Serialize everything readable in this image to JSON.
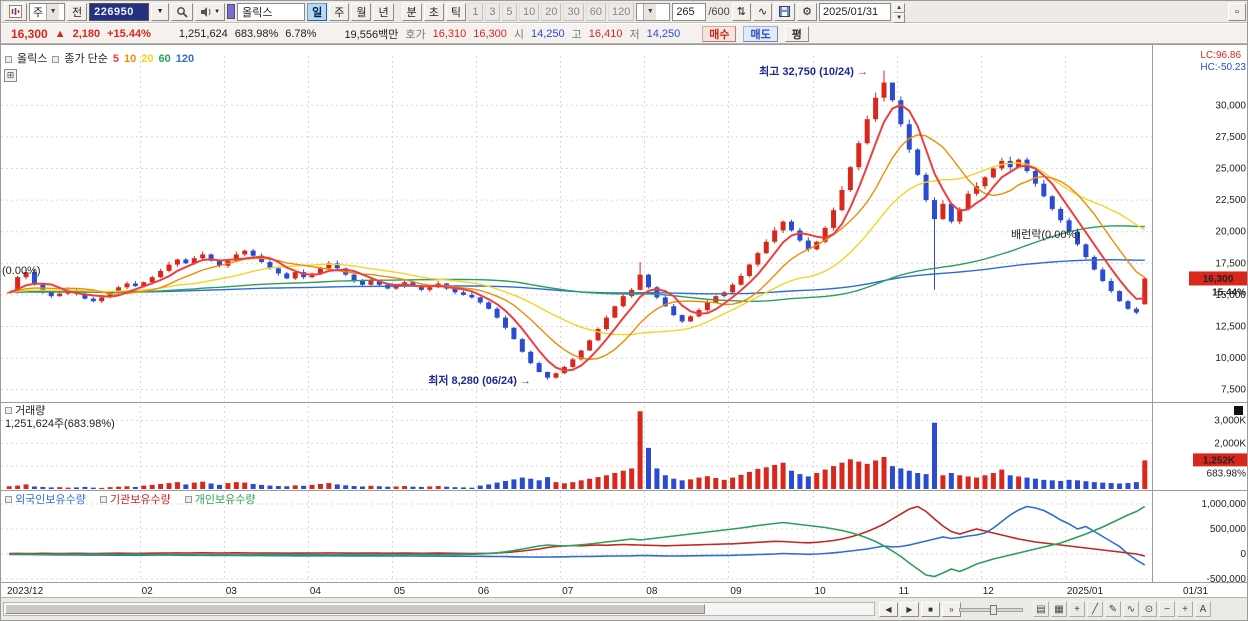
{
  "icons": {
    "caret_down": "▼",
    "spinner_up": "▲",
    "spinner_down": "▼",
    "arrow_right": "→",
    "updown": "⇅",
    "wave": "∿",
    "gear": "⚙",
    "square": "▫",
    "grid": "⊞"
  },
  "toolbar": {
    "market_type": "주",
    "prev_label": "전",
    "code_value": "226950",
    "name_value": "올릭스",
    "periods": [
      "일",
      "주",
      "월",
      "년",
      "분",
      "초",
      "틱"
    ],
    "active_period": "일",
    "minutes": [
      "1",
      "3",
      "5",
      "10",
      "20",
      "30",
      "60",
      "120"
    ],
    "count_value": "265",
    "count_total": "/600",
    "date_value": "2025/01/31"
  },
  "quote": {
    "price": "16,300",
    "arrow": "▲",
    "change": "2,180",
    "change_pct": "+15.44%",
    "volume": "1,251,624",
    "volume_pct": "683.98%",
    "turnover_pct": "6.78%",
    "value": "19,556백만",
    "hoga_label": "호가",
    "ask": "16,310",
    "bid": "16,300",
    "open_label": "시",
    "open": "14,250",
    "high_label": "고",
    "high": "16,410",
    "low_label": "저",
    "low": "14,250",
    "buy_button": "매수",
    "sell_button": "매도",
    "avg_button": "평"
  },
  "legend": {
    "name": "올릭스",
    "ma_label": "종가 단순",
    "ma_periods": [
      "5",
      "10",
      "20",
      "60",
      "120"
    ]
  },
  "corner": {
    "lc": "LC:96.86",
    "hc": "HC:-50.23"
  },
  "annotations": {
    "high": "최고 32,750 (10/24)",
    "low": "최저 8,280 (06/24)",
    "overlay": "배런락(0.00%)",
    "overlay_left": "(0.00%)"
  },
  "price_axis": {
    "badge": "16,300",
    "badge_pct": "15.44%"
  },
  "volume_panel": {
    "title": "거래량",
    "subtitle": "1,251,624주(683.98%)",
    "badge": "1,252K",
    "badge_pct": "683.98%"
  },
  "bottom": {
    "scroll_left": "◀",
    "scroll_right": "▶",
    "scroll_stop": "■",
    "scroll_end": "»",
    "tools": [
      {
        "name": "split-screen",
        "glyph": "▤"
      },
      {
        "name": "multi-chart",
        "glyph": "▦"
      },
      {
        "name": "crosshair",
        "glyph": "+"
      },
      {
        "name": "trendline",
        "glyph": "╱"
      },
      {
        "name": "pencil",
        "glyph": "✎"
      },
      {
        "name": "indicator",
        "glyph": "∿"
      },
      {
        "name": "magnifier",
        "glyph": "⊙"
      },
      {
        "name": "zoom-out",
        "glyph": "−"
      },
      {
        "name": "zoom-in",
        "glyph": "+"
      },
      {
        "name": "font-size",
        "glyph": "A"
      }
    ]
  },
  "chart_data": {
    "type": "candlestick+volume+lines",
    "symbol": "올릭스",
    "period": "일",
    "visible_range": "2023/12 - 2025/01/31",
    "price_range": [
      7000,
      33900
    ],
    "colors": {
      "up": "#d8281e",
      "down": "#2b4bd0"
    },
    "price_axis_ticks": [
      {
        "t": "30,000",
        "p": 30000
      },
      {
        "t": "27,500",
        "p": 27500
      },
      {
        "t": "25,000",
        "p": 25000
      },
      {
        "t": "22,500",
        "p": 22500
      },
      {
        "t": "20,000",
        "p": 20000
      },
      {
        "t": "17,500",
        "p": 17500
      },
      {
        "t": "15,000",
        "p": 15000
      },
      {
        "t": "12,500",
        "p": 12500
      },
      {
        "t": "10,000",
        "p": 10000
      },
      {
        "t": "7,500",
        "p": 7500
      }
    ],
    "price_badge_value": 16300,
    "months": [
      {
        "t": "2023/12",
        "idx": 0
      },
      {
        "t": "02",
        "idx": 16
      },
      {
        "t": "03",
        "idx": 26
      },
      {
        "t": "04",
        "idx": 36
      },
      {
        "t": "05",
        "idx": 46
      },
      {
        "t": "06",
        "idx": 56
      },
      {
        "t": "07",
        "idx": 66
      },
      {
        "t": "08",
        "idx": 76
      },
      {
        "t": "09",
        "idx": 86
      },
      {
        "t": "10",
        "idx": 96
      },
      {
        "t": "11",
        "idx": 106
      },
      {
        "t": "12",
        "idx": 116
      },
      {
        "t": "2025/01",
        "idx": 126
      }
    ],
    "last_label": "01/31",
    "candles": {
      "close": [
        15200,
        16400,
        16800,
        15800,
        15200,
        14900,
        15100,
        15400,
        15100,
        14700,
        14500,
        14800,
        15200,
        15600,
        15900,
        15700,
        16000,
        16400,
        16900,
        17400,
        17800,
        17500,
        17900,
        18200,
        17700,
        17300,
        17700,
        18200,
        18500,
        18100,
        17600,
        17100,
        16700,
        16300,
        16800,
        16400,
        16700,
        17100,
        17500,
        17100,
        16600,
        16100,
        15800,
        16100,
        15800,
        15500,
        15700,
        16000,
        15700,
        15400,
        15600,
        15900,
        15500,
        15200,
        15000,
        14800,
        14400,
        13900,
        13200,
        12400,
        11500,
        10500,
        9600,
        8900,
        8450,
        8800,
        9300,
        9900,
        10600,
        11400,
        12300,
        13200,
        14100,
        14900,
        15400,
        16600,
        15600,
        14800,
        14100,
        13400,
        12900,
        13300,
        13800,
        14400,
        14900,
        15200,
        15800,
        16500,
        17400,
        18300,
        19200,
        20100,
        20800,
        20100,
        19300,
        18600,
        19200,
        20300,
        21700,
        23300,
        25100,
        27000,
        28900,
        30600,
        31800,
        30400,
        28500,
        26500,
        24500,
        22500,
        21000,
        22200,
        20800,
        21800,
        23000,
        23600,
        24300,
        25000,
        25600,
        25100,
        25700,
        24800,
        23800,
        22800,
        21800,
        20900,
        20000,
        19000,
        18000,
        17000,
        16100,
        15300,
        14500,
        13900,
        13600,
        16300
      ],
      "overrides": {
        "64": {
          "low": 8280
        },
        "75": {
          "high": 17600
        },
        "104": {
          "high": 32750
        },
        "105": {
          "high": 31600
        },
        "110": {
          "low": 15400
        },
        "135": {
          "open": 14250,
          "high": 16410,
          "low": 14250,
          "close": 16300
        }
      }
    },
    "ma_periods": [
      5,
      10,
      20,
      60,
      120
    ],
    "ma_colors": [
      "#f03e3e",
      "#f08c00",
      "#f5d327",
      "#2aa05a",
      "#2f6bd8"
    ],
    "volume_max_k": 3500,
    "volume_grid_k": [
      1000,
      2000,
      3000
    ],
    "volume_ticks": [
      {
        "t": "3,000K",
        "v": 3000
      },
      {
        "t": "2,000K",
        "v": 2000
      }
    ],
    "volume_badge_value_k": 1252,
    "volume_k": [
      120,
      150,
      200,
      110,
      90,
      70,
      80,
      60,
      70,
      90,
      60,
      50,
      80,
      100,
      120,
      90,
      150,
      180,
      220,
      260,
      300,
      200,
      280,
      320,
      240,
      180,
      260,
      300,
      280,
      220,
      180,
      150,
      130,
      120,
      160,
      140,
      180,
      220,
      260,
      200,
      160,
      130,
      110,
      140,
      120,
      100,
      110,
      130,
      100,
      90,
      110,
      130,
      100,
      80,
      70,
      60,
      150,
      200,
      280,
      350,
      420,
      500,
      450,
      380,
      520,
      300,
      250,
      300,
      380,
      450,
      520,
      600,
      700,
      800,
      900,
      3400,
      1800,
      900,
      600,
      450,
      380,
      420,
      500,
      560,
      480,
      400,
      500,
      620,
      750,
      880,
      950,
      1050,
      1150,
      800,
      650,
      550,
      700,
      850,
      1000,
      1150,
      1300,
      1200,
      1100,
      1250,
      1400,
      1000,
      900,
      800,
      700,
      650,
      2900,
      600,
      700,
      600,
      550,
      500,
      600,
      700,
      850,
      600,
      550,
      500,
      450,
      400,
      380,
      350,
      400,
      380,
      340,
      300,
      280,
      260,
      240,
      260,
      300,
      1252
    ],
    "ownership_ticks": [
      {
        "t": "1,000,000",
        "v": 1000
      },
      {
        "t": "500,000",
        "v": 500
      },
      {
        "t": "0",
        "v": 0
      },
      {
        "t": "-500,000",
        "v": -500
      }
    ],
    "ownership_unit_scale": 1000,
    "ownership_series": [
      {
        "name": "외국인보유수량",
        "color": "#2f6bd8",
        "values_k": [
          -5,
          -8,
          -10,
          -12,
          -14,
          -16,
          -18,
          -20,
          -20,
          -22,
          -20,
          -22,
          -24,
          -22,
          -24,
          -25,
          -24,
          -22,
          -20,
          -22,
          -24,
          -26,
          -24,
          -26,
          -28,
          -30,
          -28,
          -30,
          -32,
          -30,
          -32,
          -34,
          -32,
          -34,
          -36,
          -35,
          -34,
          -36,
          -35,
          -36,
          -38,
          -36,
          -38,
          -40,
          -38,
          -40,
          -40,
          -38,
          -40,
          -42,
          -40,
          -42,
          -44,
          -42,
          -44,
          -45,
          -45,
          -48,
          -50,
          -52,
          -55,
          -58,
          -60,
          -62,
          -60,
          -58,
          -55,
          -52,
          -50,
          -48,
          -45,
          -42,
          -40,
          -38,
          -35,
          -30,
          -32,
          -35,
          -38,
          -40,
          -38,
          -36,
          -34,
          -32,
          -30,
          -28,
          -25,
          -20,
          -15,
          -10,
          -5,
          0,
          10,
          5,
          0,
          -5,
          0,
          10,
          25,
          40,
          60,
          80,
          100,
          130,
          160,
          140,
          150,
          180,
          220,
          260,
          300,
          340,
          310,
          330,
          360,
          380,
          420,
          520,
          650,
          780,
          880,
          950,
          920,
          870,
          780,
          680,
          600,
          500,
          550,
          450,
          350,
          250,
          150,
          0,
          -120,
          -220
        ]
      },
      {
        "name": "기관보유수량",
        "color": "#c0281e",
        "values_k": [
          10,
          12,
          8,
          10,
          14,
          12,
          10,
          12,
          14,
          12,
          10,
          12,
          14,
          16,
          14,
          12,
          14,
          16,
          18,
          20,
          22,
          20,
          22,
          24,
          22,
          20,
          22,
          24,
          22,
          20,
          18,
          20,
          18,
          16,
          18,
          20,
          18,
          20,
          22,
          20,
          18,
          16,
          18,
          20,
          18,
          16,
          16,
          18,
          16,
          14,
          16,
          18,
          16,
          14,
          12,
          10,
          12,
          15,
          20,
          30,
          45,
          60,
          80,
          100,
          130,
          150,
          160,
          170,
          165,
          175,
          180,
          175,
          185,
          190,
          185,
          180,
          175,
          170,
          165,
          170,
          175,
          180,
          185,
          190,
          195,
          200,
          205,
          215,
          225,
          235,
          245,
          255,
          250,
          240,
          230,
          225,
          235,
          250,
          270,
          300,
          340,
          390,
          450,
          520,
          600,
          700,
          800,
          900,
          950,
          850,
          700,
          560,
          450,
          400,
          450,
          500,
          460,
          420,
          380,
          340,
          300,
          270,
          240,
          220,
          200,
          180,
          160,
          140,
          120,
          100,
          80,
          60,
          40,
          20,
          0,
          -40
        ]
      },
      {
        "name": "개인보유수량",
        "color": "#2aa05a",
        "values_k": [
          -5,
          -6,
          -4,
          -6,
          -8,
          -6,
          -4,
          -6,
          -8,
          -6,
          -4,
          -6,
          -8,
          -10,
          -8,
          -6,
          -8,
          -10,
          -12,
          -14,
          -16,
          -14,
          -16,
          -18,
          -16,
          -14,
          -16,
          -18,
          -16,
          -14,
          -12,
          -14,
          -12,
          -10,
          -12,
          -14,
          -12,
          -14,
          -16,
          -14,
          -12,
          -10,
          -12,
          -14,
          -12,
          -10,
          -10,
          -12,
          -10,
          -8,
          -10,
          -12,
          -10,
          -8,
          -6,
          -5,
          0,
          10,
          25,
          45,
          70,
          100,
          130,
          160,
          180,
          170,
          160,
          170,
          185,
          200,
          220,
          240,
          260,
          280,
          300,
          280,
          300,
          320,
          340,
          360,
          380,
          400,
          420,
          440,
          460,
          480,
          500,
          520,
          545,
          570,
          590,
          610,
          630,
          610,
          590,
          570,
          550,
          530,
          500,
          470,
          430,
          380,
          320,
          250,
          160,
          60,
          -50,
          -180,
          -300,
          -420,
          -450,
          -380,
          -300,
          -350,
          -280,
          -200,
          -150,
          -100,
          -60,
          -20,
          20,
          60,
          100,
          140,
          180,
          220,
          280,
          340,
          400,
          470,
          540,
          620,
          700,
          780,
          850,
          950
        ]
      }
    ]
  }
}
